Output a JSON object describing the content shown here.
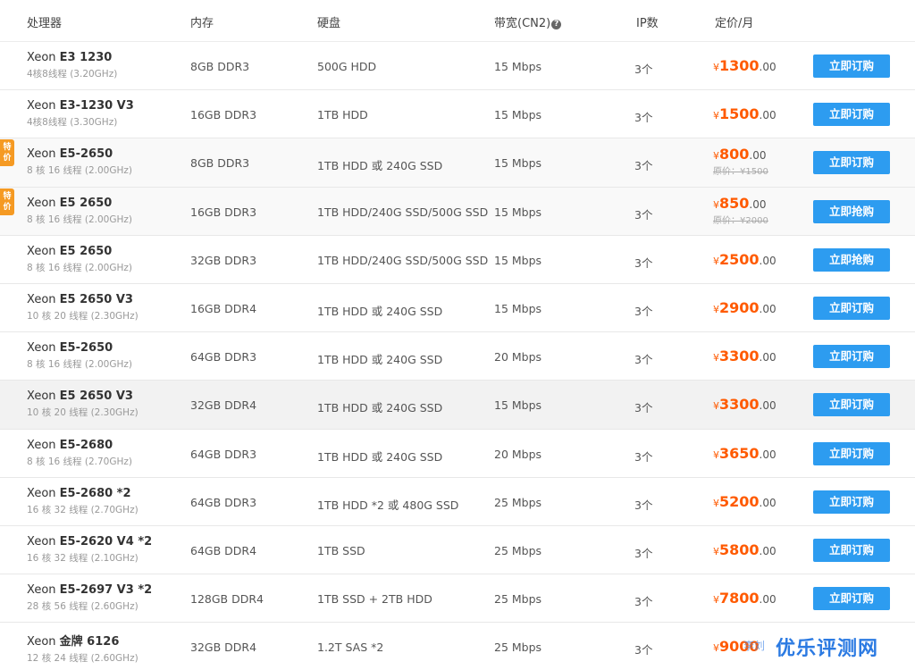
{
  "header": {
    "cpu": "处理器",
    "memory": "内存",
    "disk": "硬盘",
    "bandwidth": "带宽(CN2)",
    "ip": "IP数",
    "price": "定价/月"
  },
  "currency": "¥",
  "colors": {
    "accent_button": "#2d9cf0",
    "price": "#ff5a00",
    "badge": "#f59a23"
  },
  "rows": [
    {
      "brand": "Xeon",
      "model": "E3 1230",
      "cores": "4核8线程 (3.20GHz)",
      "memory": "8GB DDR3",
      "disk": "500G HDD",
      "bandwidth": "15 Mbps",
      "ip": "3个",
      "price": "1300",
      "decimal": ".00",
      "button": "立即订购"
    },
    {
      "brand": "Xeon",
      "model": "E3-1230 V3",
      "cores": "4核8线程 (3.30GHz)",
      "memory": "16GB DDR3",
      "disk": "1TB HDD",
      "bandwidth": "15 Mbps",
      "ip": "3个",
      "price": "1500",
      "decimal": ".00",
      "button": "立即订购"
    },
    {
      "brand": "Xeon",
      "model": "E5-2650",
      "cores": "8 核 16 线程 (2.00GHz)",
      "memory": "8GB DDR3",
      "disk": "1TB HDD 或 240G SSD",
      "bandwidth": "15 Mbps",
      "ip": "3个",
      "price": "800",
      "decimal": ".00",
      "original": "原价：¥1500",
      "badge": "特价",
      "button": "立即订购"
    },
    {
      "brand": "Xeon",
      "model": "E5 2650",
      "cores": "8 核 16 线程 (2.00GHz)",
      "memory": "16GB DDR3",
      "disk": "1TB HDD/240G SSD/500G SSD",
      "bandwidth": "15 Mbps",
      "ip": "3个",
      "price": "850",
      "decimal": ".00",
      "original": "原价：¥2000",
      "badge": "特价",
      "button": "立即抢购"
    },
    {
      "brand": "Xeon",
      "model": "E5 2650",
      "cores": "8 核 16 线程 (2.00GHz)",
      "memory": "32GB DDR3",
      "disk": "1TB HDD/240G SSD/500G SSD",
      "bandwidth": "15 Mbps",
      "ip": "3个",
      "price": "2500",
      "decimal": ".00",
      "button": "立即抢购"
    },
    {
      "brand": "Xeon",
      "model": "E5 2650 V3",
      "cores": "10 核 20 线程 (2.30GHz)",
      "memory": "16GB DDR4",
      "disk": "1TB HDD 或 240G SSD",
      "bandwidth": "15 Mbps",
      "ip": "3个",
      "price": "2900",
      "decimal": ".00",
      "button": "立即订购"
    },
    {
      "brand": "Xeon",
      "model": "E5-2650",
      "cores": "8 核 16 线程 (2.00GHz)",
      "memory": "64GB DDR3",
      "disk": "1TB HDD 或 240G SSD",
      "bandwidth": "20 Mbps",
      "ip": "3个",
      "price": "3300",
      "decimal": ".00",
      "button": "立即订购"
    },
    {
      "brand": "Xeon",
      "model": "E5 2650 V3",
      "cores": "10 核 20 线程 (2.30GHz)",
      "memory": "32GB DDR4",
      "disk": "1TB HDD 或 240G SSD",
      "bandwidth": "15 Mbps",
      "ip": "3个",
      "price": "3300",
      "decimal": ".00",
      "button": "立即订购"
    },
    {
      "brand": "Xeon",
      "model": "E5-2680",
      "cores": "8 核 16 线程 (2.70GHz)",
      "memory": "64GB DDR3",
      "disk": "1TB HDD 或 240G SSD",
      "bandwidth": "20 Mbps",
      "ip": "3个",
      "price": "3650",
      "decimal": ".00",
      "button": "立即订购"
    },
    {
      "brand": "Xeon",
      "model": "E5-2680 *2",
      "cores": "16 核 32 线程 (2.70GHz)",
      "memory": "64GB DDR3",
      "disk": "1TB HDD *2 或 480G SSD",
      "bandwidth": "25 Mbps",
      "ip": "3个",
      "price": "5200",
      "decimal": ".00",
      "button": "立即订购"
    },
    {
      "brand": "Xeon",
      "model": "E5-2620 V4 *2",
      "cores": "16 核 32 线程 (2.10GHz)",
      "memory": "64GB DDR4",
      "disk": "1TB SSD",
      "bandwidth": "25 Mbps",
      "ip": "3个",
      "price": "5800",
      "decimal": ".00",
      "button": "立即订购"
    },
    {
      "brand": "Xeon",
      "model": "E5-2697 V3 *2",
      "cores": "28 核 56 线程 (2.60GHz)",
      "memory": "128GB DDR4",
      "disk": "1TB SSD + 2TB HDD",
      "bandwidth": "25 Mbps",
      "ip": "3个",
      "price": "7800",
      "decimal": ".00",
      "button": "立即订购"
    },
    {
      "brand": "Xeon",
      "model": "金牌 6126",
      "cores": "12 核 24 线程 (2.60GHz)",
      "memory": "32GB DDR4",
      "disk": "1.2T SAS *2",
      "bandwidth": "25 Mbps",
      "ip": "3个",
      "price": "9000",
      "decimal": "",
      "button": ""
    }
  ],
  "watermark": {
    "main": "优乐评测网",
    "small": "李刘"
  }
}
